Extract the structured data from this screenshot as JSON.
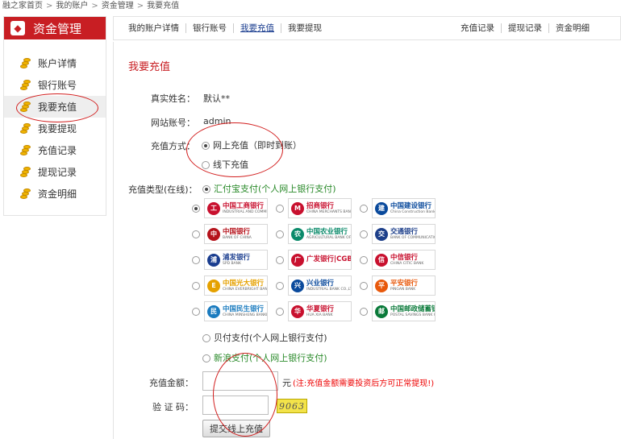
{
  "breadcrumb": [
    "融之家首页",
    "我的账户",
    "资金管理",
    "我要充值"
  ],
  "breadcrumb_sep": ">",
  "sidebar": {
    "title": "资金管理",
    "items": [
      {
        "label": "账户详情"
      },
      {
        "label": "银行账号"
      },
      {
        "label": "我要充值",
        "active": true
      },
      {
        "label": "我要提现"
      },
      {
        "label": "充值记录"
      },
      {
        "label": "提现记录"
      },
      {
        "label": "资金明细"
      }
    ]
  },
  "topnav": {
    "left": [
      "我的账户详情",
      "银行账号",
      "我要充值",
      "我要提现"
    ],
    "right": [
      "充值记录",
      "提现记录",
      "资金明细"
    ]
  },
  "form": {
    "title": "我要充值",
    "realname_label": "真实姓名：",
    "realname_value": "默认**",
    "account_label": "网站账号：",
    "account_value": "admin",
    "method_label": "充值方式：",
    "method_online": "网上充值（即时到账）",
    "method_offline": "线下充值",
    "type_label": "充值类型(在线)：",
    "gateway_1": "汇付宝支付(个人网上银行支付)",
    "gateway_2": "贝付支付(个人网上银行支付)",
    "gateway_3": "新浪支付(个人网上银行支付)",
    "amount_label": "充值金额：",
    "amount_unit": "元",
    "amount_note": "(注:充值金额需要投资后方可正常提现!)",
    "amount_value": "",
    "code_label": "验 证 码：",
    "code_value": "",
    "captcha_text": "9063",
    "submit_label": "提交线上充值"
  },
  "banks": [
    {
      "name": "中国工商银行",
      "en": "INDUSTRIAL AND COMMERCIAL BANK OF CHINA",
      "color": "#c8102e",
      "glyph": "工"
    },
    {
      "name": "招商银行",
      "en": "CHINA MERCHANTS BANK",
      "color": "#c8102e",
      "glyph": "M"
    },
    {
      "name": "中国建设银行",
      "en": "China Construction Bank",
      "color": "#0a4a9c",
      "glyph": "建"
    },
    {
      "name": "中国银行",
      "en": "BANK OF CHINA",
      "color": "#b5121b",
      "glyph": "中"
    },
    {
      "name": "中国农业银行",
      "en": "AGRICULTURAL BANK OF CHINA",
      "color": "#0a8a6a",
      "glyph": "农"
    },
    {
      "name": "交通银行",
      "en": "BANK OF COMMUNICATIONS",
      "color": "#1d3f8a",
      "glyph": "交"
    },
    {
      "name": "浦发银行",
      "en": "SPD BANK",
      "color": "#1a3d8f",
      "glyph": "浦"
    },
    {
      "name": "广发银行|CGB",
      "en": "",
      "color": "#c8102e",
      "glyph": "广"
    },
    {
      "name": "中信银行",
      "en": "CHINA CITIC BANK",
      "color": "#c8102e",
      "glyph": "信"
    },
    {
      "name": "中国光大银行",
      "en": "CHINA EVERBRIGHT BANK",
      "color": "#e5a100",
      "glyph": "E"
    },
    {
      "name": "兴业银行",
      "en": "INDUSTRIAL BANK CO.,LTD",
      "color": "#0a4a9c",
      "glyph": "兴"
    },
    {
      "name": "平安银行",
      "en": "PINGAN BANK",
      "color": "#e8590c",
      "glyph": "平"
    },
    {
      "name": "中国民生银行",
      "en": "CHINA MINSHENG BANKING CORP.,LTD",
      "color": "#1a7bbf",
      "glyph": "民"
    },
    {
      "name": "华夏银行",
      "en": "HUA XIA BANK",
      "color": "#c8102e",
      "glyph": "华"
    },
    {
      "name": "中国邮政储蓄银行",
      "en": "POSTAL SAVINGS BANK OF CHINA",
      "color": "#0a7a3a",
      "glyph": "邮"
    }
  ],
  "colors": {
    "accent": "#c81e23",
    "green_text": "#2a8a2a",
    "link": "#1a3d8f",
    "annotation": "#d21e1e"
  }
}
